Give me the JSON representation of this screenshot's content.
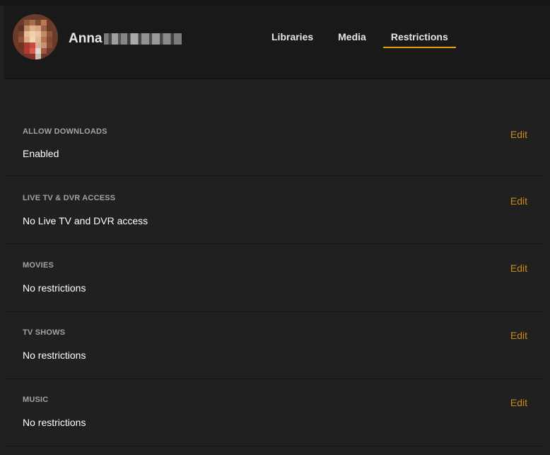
{
  "user": {
    "name_visible": "Anna"
  },
  "tabs": [
    {
      "label": "Libraries",
      "active": false
    },
    {
      "label": "Media",
      "active": false
    },
    {
      "label": "Restrictions",
      "active": true
    }
  ],
  "accent_color": "#e5a00d",
  "edit_color": "#cc8a16",
  "sections": [
    {
      "label": "ALLOW DOWNLOADS",
      "value": "Enabled",
      "edit": "Edit"
    },
    {
      "label": "LIVE TV & DVR ACCESS",
      "value": "No Live TV and DVR access",
      "edit": "Edit"
    },
    {
      "label": "MOVIES",
      "value": "No restrictions",
      "edit": "Edit"
    },
    {
      "label": "TV SHOWS",
      "value": "No restrictions",
      "edit": "Edit"
    },
    {
      "label": "MUSIC",
      "value": "No restrictions",
      "edit": "Edit"
    }
  ]
}
